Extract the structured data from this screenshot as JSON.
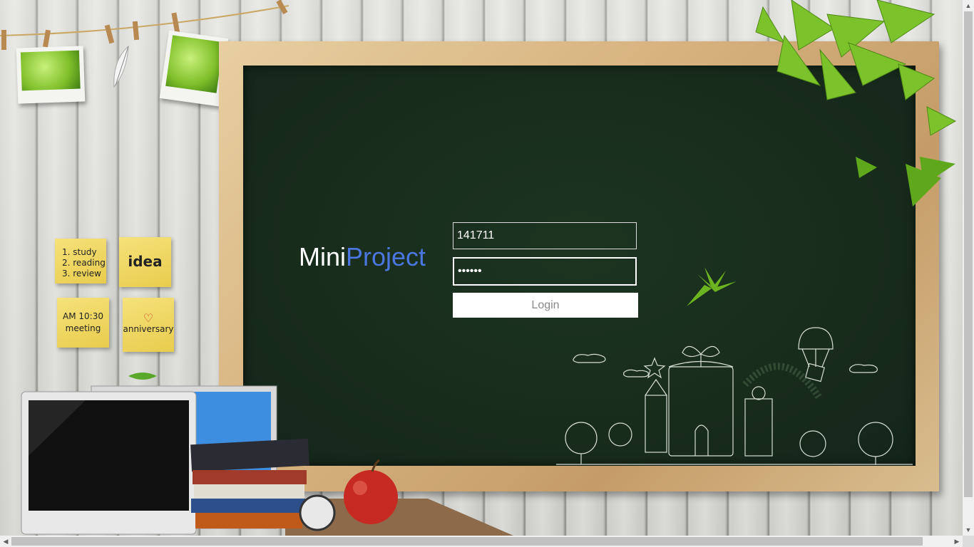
{
  "brand": {
    "part1": "Mini",
    "part2": "Project"
  },
  "form": {
    "username_value": "141711",
    "password_value": "123456",
    "login_label": "Login"
  },
  "notes": {
    "list": [
      "1. study",
      "2. reading",
      "3. review"
    ],
    "idea": "idea",
    "meeting_time": "AM 10:30",
    "meeting_label": "meeting",
    "anniversary": "anniversary"
  },
  "colors": {
    "board": "#182c1c",
    "brand_accent": "#4b76e0",
    "brand_white": "#ffffff"
  },
  "icons": {
    "scroll_up": "▲",
    "scroll_down": "▼",
    "scroll_left": "◀",
    "scroll_right": "▶"
  }
}
